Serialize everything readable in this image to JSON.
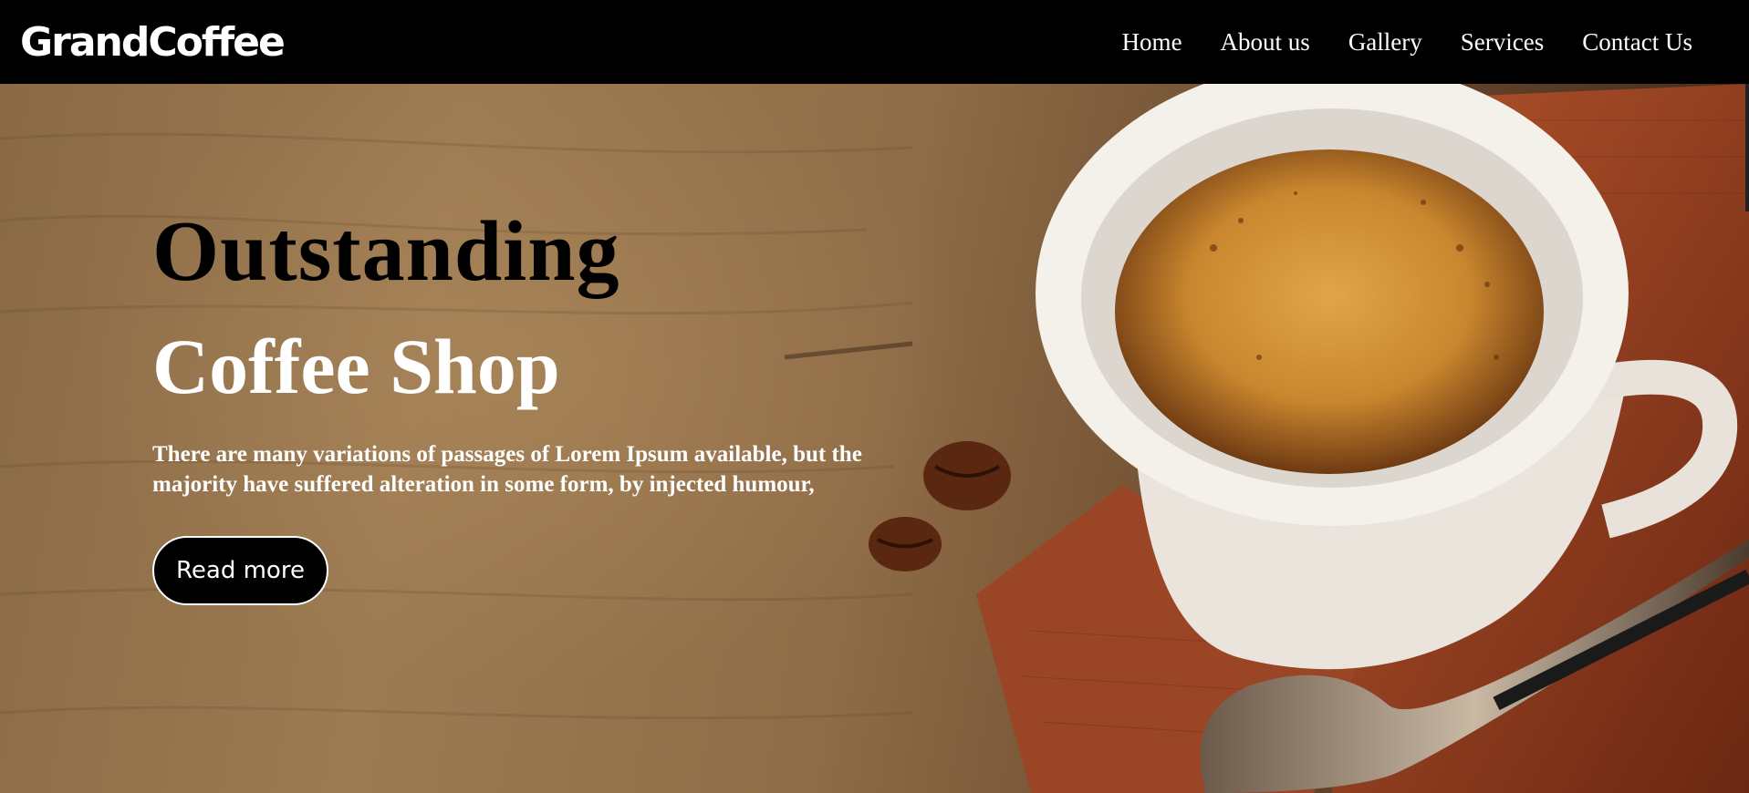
{
  "brand": {
    "logo": "GrandCoffee"
  },
  "nav": {
    "items": [
      {
        "label": "Home"
      },
      {
        "label": "About us"
      },
      {
        "label": "Gallery"
      },
      {
        "label": "Services"
      },
      {
        "label": "Contact Us"
      }
    ]
  },
  "hero": {
    "title_line1": "Outstanding",
    "title_line2": "Coffee Shop",
    "description": "There are many variations of passages of Lorem Ipsum available, but the majority have suffered alteration in some form, by injected humour,",
    "button_label": "Read more"
  },
  "colors": {
    "navbar_bg": "#000000",
    "nav_text": "#ffffff",
    "button_bg": "#000000",
    "wood": "#8a6a46"
  }
}
